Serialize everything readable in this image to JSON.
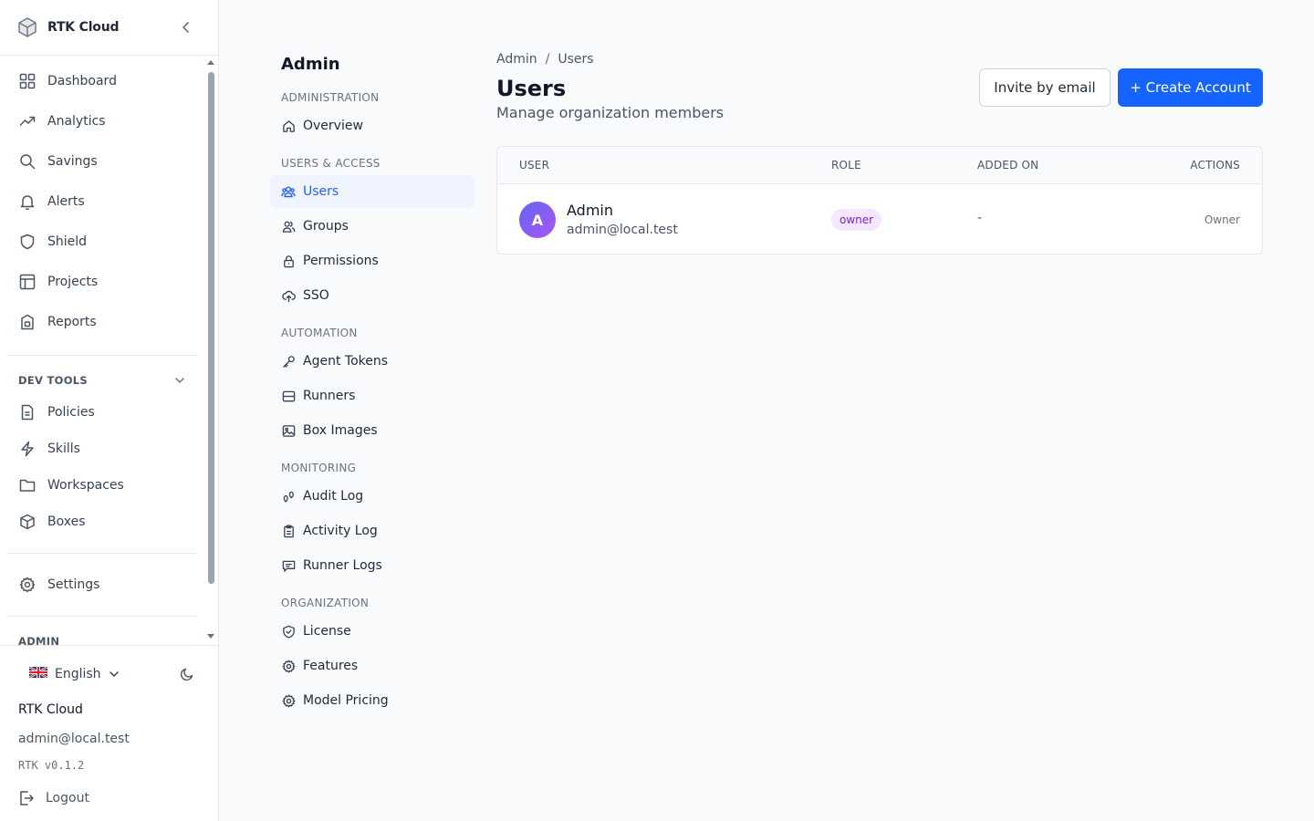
{
  "app": {
    "name": "RTK Cloud",
    "version": "RTK v0.1.2"
  },
  "sidebar": {
    "items": [
      {
        "label": "Dashboard",
        "icon": "grid-icon"
      },
      {
        "label": "Analytics",
        "icon": "trend-icon"
      },
      {
        "label": "Savings",
        "icon": "search-icon"
      },
      {
        "label": "Alerts",
        "icon": "bell-icon"
      },
      {
        "label": "Shield",
        "icon": "shield-icon"
      },
      {
        "label": "Projects",
        "icon": "table-icon"
      },
      {
        "label": "Reports",
        "icon": "report-icon"
      }
    ],
    "dev_tools": {
      "title": "DEV TOOLS",
      "items": [
        {
          "label": "Policies",
          "icon": "document-icon"
        },
        {
          "label": "Skills",
          "icon": "lightning-icon"
        },
        {
          "label": "Workspaces",
          "icon": "folder-icon"
        },
        {
          "label": "Boxes",
          "icon": "cube-icon"
        }
      ]
    },
    "settings_label": "Settings",
    "admin_section_title": "ADMIN",
    "footer": {
      "language": "English",
      "org_name": "RTK Cloud",
      "email": "admin@local.test",
      "logout": "Logout"
    }
  },
  "admin_nav": {
    "title": "Admin",
    "groups": [
      {
        "label": "ADMINISTRATION",
        "items": [
          {
            "label": "Overview",
            "icon": "home-icon"
          }
        ]
      },
      {
        "label": "USERS & ACCESS",
        "items": [
          {
            "label": "Users",
            "icon": "users-icon",
            "active": true
          },
          {
            "label": "Groups",
            "icon": "group-icon"
          },
          {
            "label": "Permissions",
            "icon": "lock-icon"
          },
          {
            "label": "SSO",
            "icon": "cloud-upload-icon"
          }
        ]
      },
      {
        "label": "AUTOMATION",
        "items": [
          {
            "label": "Agent Tokens",
            "icon": "key-icon"
          },
          {
            "label": "Runners",
            "icon": "server-icon"
          },
          {
            "label": "Box Images",
            "icon": "image-icon"
          }
        ]
      },
      {
        "label": "MONITORING",
        "items": [
          {
            "label": "Audit Log",
            "icon": "footprints-icon"
          },
          {
            "label": "Activity Log",
            "icon": "clipboard-icon"
          },
          {
            "label": "Runner Logs",
            "icon": "message-icon"
          }
        ]
      },
      {
        "label": "ORGANIZATION",
        "items": [
          {
            "label": "License",
            "icon": "shield-check-icon"
          },
          {
            "label": "Features",
            "icon": "gear-icon"
          },
          {
            "label": "Model Pricing",
            "icon": "gear-icon"
          }
        ]
      }
    ]
  },
  "main": {
    "breadcrumb": [
      "Admin",
      "Users"
    ],
    "breadcrumb_sep": "/",
    "title": "Users",
    "subtitle": "Manage organization members",
    "invite_button": "Invite by email",
    "create_button": "+ Create Account",
    "table": {
      "columns": [
        "USER",
        "ROLE",
        "ADDED ON",
        "ACTIONS"
      ],
      "rows": [
        {
          "initial": "A",
          "name": "Admin",
          "email": "admin@local.test",
          "role": "owner",
          "added_on": "-",
          "action": "Owner"
        }
      ]
    }
  },
  "colors": {
    "accent": "#1664ff",
    "active_bg": "#eff4ff",
    "active_text": "#2563eb",
    "badge_bg": "#f3e8ff",
    "badge_text": "#7e22ce"
  }
}
